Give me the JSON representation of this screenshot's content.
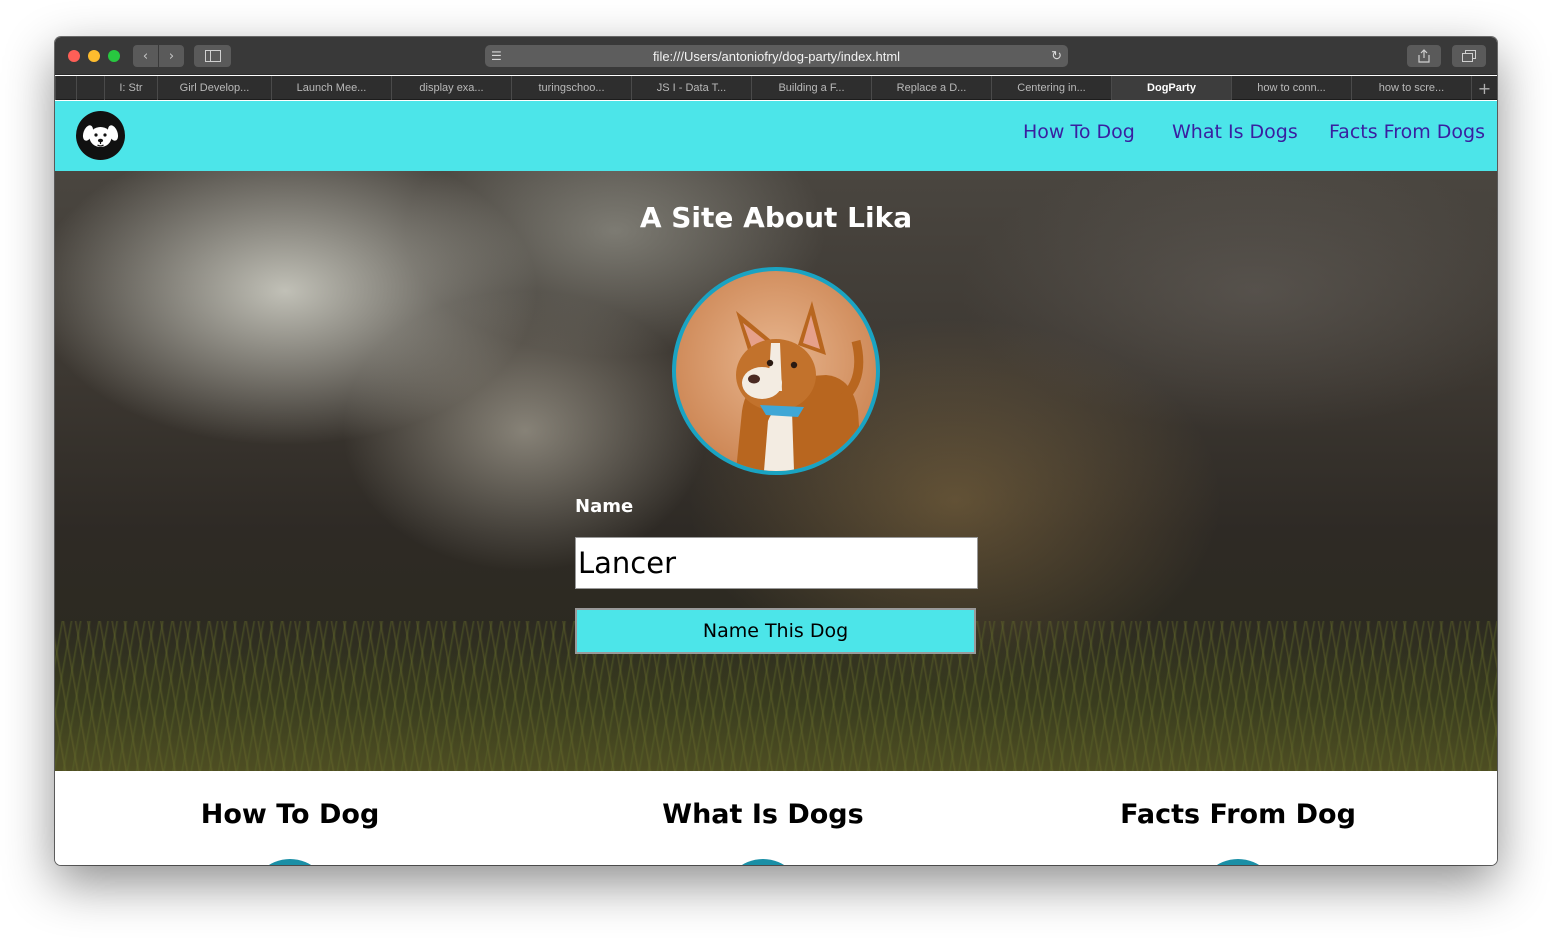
{
  "browser": {
    "url": "file:///Users/antoniofry/dog-party/index.html",
    "tabs": [
      {
        "label": "",
        "active": false
      },
      {
        "label": "",
        "active": false
      },
      {
        "label": "I: Str",
        "active": false
      },
      {
        "label": "Girl Develop...",
        "active": false
      },
      {
        "label": "Launch Mee...",
        "active": false
      },
      {
        "label": "display exa...",
        "active": false
      },
      {
        "label": "turingschoo...",
        "active": false
      },
      {
        "label": "JS I - Data T...",
        "active": false
      },
      {
        "label": "Building a F...",
        "active": false
      },
      {
        "label": "Replace a D...",
        "active": false
      },
      {
        "label": "Centering in...",
        "active": false
      },
      {
        "label": "DogParty",
        "active": true
      },
      {
        "label": "how to conn...",
        "active": false
      },
      {
        "label": "how to scre...",
        "active": false
      }
    ],
    "new_tab_label": "+"
  },
  "header": {
    "nav": [
      "How To Dog",
      "What Is Dogs",
      "Facts From Dogs"
    ]
  },
  "hero": {
    "title_prefix": "A Site About ",
    "title_name": "Lika",
    "name_label": "Name",
    "name_value": "Lancer",
    "button_label": "Name This Dog"
  },
  "sections": [
    "How To Dog",
    "What Is Dogs",
    "Facts From Dog"
  ],
  "colors": {
    "header_bg": "#4ce5e9",
    "nav_link": "#3a1fa0",
    "photo_border": "#1aa3c2",
    "button_bg": "#4ce5e9"
  }
}
